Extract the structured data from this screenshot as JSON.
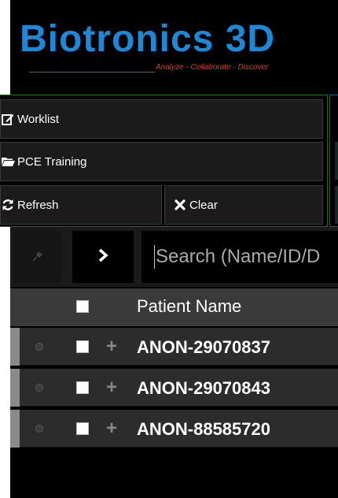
{
  "header": {
    "brand": "Biotronics 3D",
    "tagline": "Analyze - Collaborate - Discover"
  },
  "actions": {
    "worklist": "Worklist",
    "pce_training": "PCE Training",
    "refresh": "Refresh",
    "clear": "Clear"
  },
  "search": {
    "placeholder": "Search (Name/ID/D"
  },
  "table": {
    "columns": {
      "patient_name": "Patient Name"
    },
    "rows": [
      {
        "name": "ANON-29070837"
      },
      {
        "name": "ANON-29070843"
      },
      {
        "name": "ANON-88585720"
      }
    ]
  },
  "colors": {
    "brand_blue": "#1e88d6",
    "tagline_red": "#d04020",
    "panel_green_border": "#1e6a1e",
    "panel_blue_border": "#1d5b8a"
  },
  "icons": [
    "edit-icon",
    "folder-open-icon",
    "refresh-icon",
    "close-icon",
    "pin-icon",
    "chevron-right-icon",
    "plus-icon",
    "status-dot-icon"
  ]
}
